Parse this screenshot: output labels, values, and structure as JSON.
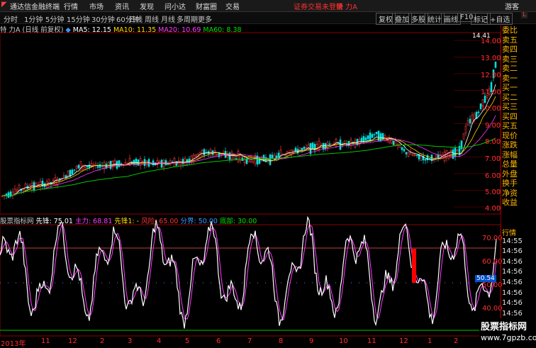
{
  "titlebar": {
    "app_name": "通达信金融终端",
    "menu": [
      "行情",
      "市场",
      "资讯",
      "发现",
      "问小达",
      "财富圈",
      "交易"
    ],
    "login_status": "证券交易未登录",
    "stock_title": "特 力A",
    "guest": "游客"
  },
  "period_tabs": [
    "分时",
    "1分钟",
    "5分钟",
    "15分钟",
    "30分钟",
    "60分钟",
    "日线",
    "周线",
    "月线",
    "多周期",
    "更多"
  ],
  "active_period": "日线",
  "toolbar": [
    "复权",
    "叠加",
    "多股",
    "统计",
    "画线",
    "F10",
    "标记",
    "+自选"
  ],
  "stock_info": {
    "label": "特 力A (日线 前复权)",
    "ma5_label": "MA5: 12.15",
    "ma10_label": "MA10: 11.35",
    "ma20_label": "MA20: 10.69",
    "ma60_label": "MA60: 8.38",
    "peak_label": "14.41"
  },
  "price_axis": [
    "14.00",
    "13.00",
    "12.00",
    "11.00",
    "10.00",
    "9.00",
    "8.00",
    "7.00",
    "6.00",
    "5.00",
    "4.00"
  ],
  "indicator": {
    "name": "股票指标网",
    "pioneer": "先锋: 75.01",
    "main": "主力: 68.81",
    "pioneer1": "先锋1: -",
    "risk": "风险: 65.00",
    "boundary": "分界: 50.00",
    "bottom": "底部: 30.00"
  },
  "indicator_axis": [
    "70.00",
    "60.00",
    "50.00",
    "40.00"
  ],
  "indicator_value_badge": "50.54",
  "date_axis": [
    "2013年",
    "11",
    "12",
    "2",
    "3",
    "4",
    "5",
    "6",
    "7",
    "8",
    "9",
    "10",
    "11",
    "12",
    "1",
    "2"
  ],
  "side_panel": [
    "委比",
    "卖五",
    "卖四",
    "卖三",
    "卖二",
    "卖一",
    "买一",
    "买二",
    "买三",
    "买四",
    "买五",
    "现价",
    "涨跌",
    "涨幅",
    "总量",
    "外盘",
    "换手",
    "净资",
    "收益"
  ],
  "side_panel_lower": [
    "行情",
    "14:55",
    "14:56",
    "14:56",
    "14:56",
    "14:56",
    "14:56",
    "14:56",
    "14:56",
    "14:56"
  ],
  "watermark_line1": "股票指标网",
  "watermark_line2": "www.7gpzb.com"
}
